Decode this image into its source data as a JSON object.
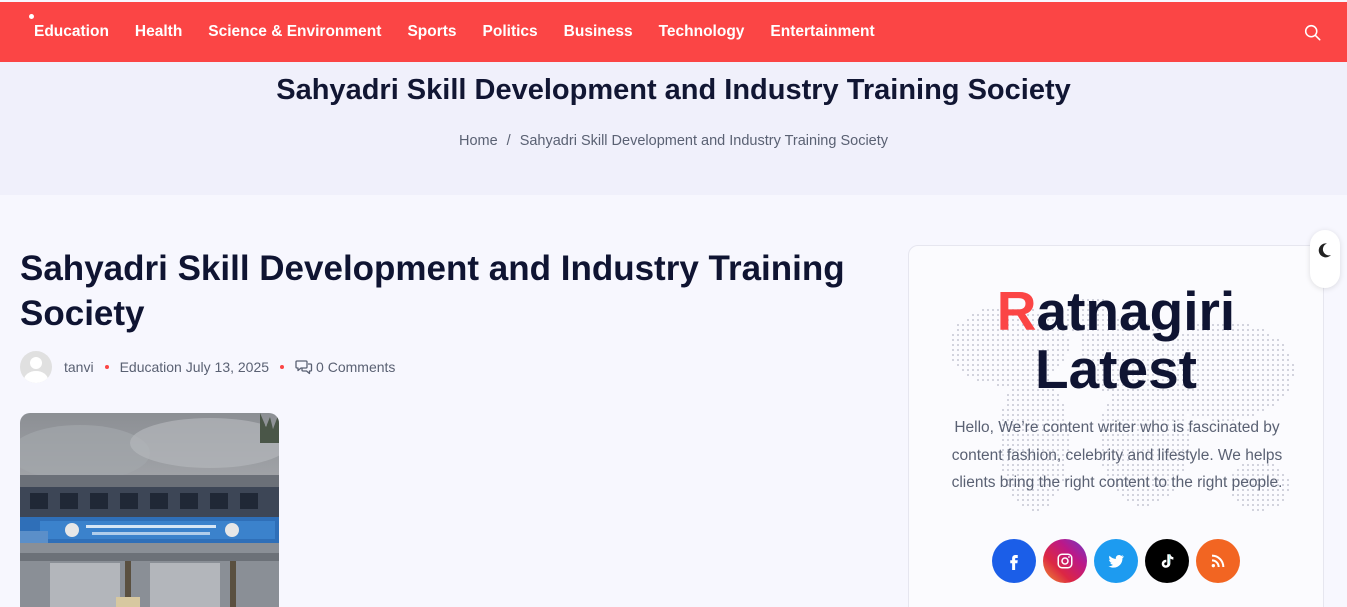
{
  "nav": {
    "items": [
      "Education",
      "Health",
      "Science & Environment",
      "Sports",
      "Politics",
      "Business",
      "Technology",
      "Entertainment"
    ],
    "search_icon": "search-icon",
    "bg_color": "#fb4545"
  },
  "banner": {
    "title": "Sahyadri Skill Development and Industry Training Society",
    "breadcrumb": {
      "home": "Home",
      "separator": "/",
      "current": "Sahyadri Skill Development and Industry Training Society"
    }
  },
  "post": {
    "title": "Sahyadri Skill Development and Industry Training Society",
    "author": "tanvi",
    "category": "Education",
    "date": "July 13, 2025",
    "comments": "0 Comments"
  },
  "sidebar": {
    "brand_first": "R",
    "brand_rest": "atnagiri",
    "brand_line2": "Latest",
    "about": "Hello, We’re content writer who is fascinated by content fashion, celebrity and lifestyle. We helps clients bring the right content to the right people.",
    "socials": [
      {
        "name": "facebook-icon",
        "color": "#1b5ee8"
      },
      {
        "name": "instagram-icon",
        "color": "#c2358f"
      },
      {
        "name": "twitter-icon",
        "color": "#1d9bf0"
      },
      {
        "name": "tiktok-icon",
        "color": "#000000"
      },
      {
        "name": "rss-icon",
        "color": "#f26522"
      }
    ]
  },
  "dark_mode_icon": "moon-icon"
}
